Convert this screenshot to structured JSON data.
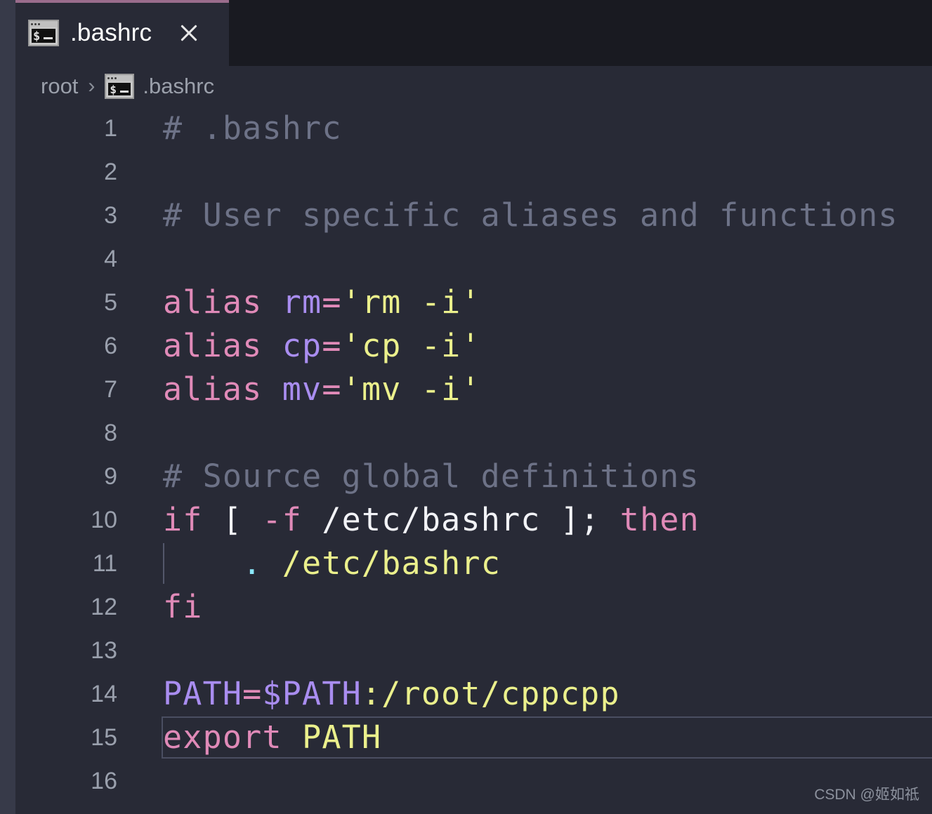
{
  "window": {
    "accent_color": "#9a6c8c",
    "editor_background": "#282a36",
    "tabbar_background": "#191a21",
    "activitybar_color": "#373a49"
  },
  "tab_bar": {
    "tabs": [
      {
        "label": ".bashrc",
        "icon": "terminal-icon",
        "active": true,
        "close_label": "×"
      }
    ]
  },
  "breadcrumb": {
    "root_label": "root",
    "separator": "›",
    "file_icon": "terminal-icon",
    "file_label": ".bashrc"
  },
  "editor": {
    "language": "shellscript",
    "current_line": 15,
    "visible_first_line": 1,
    "visible_last_line": 16,
    "lines": [
      {
        "number": "1",
        "tokens": [
          {
            "text": "# .bashrc",
            "cls": "t-comment"
          }
        ]
      },
      {
        "number": "2",
        "tokens": []
      },
      {
        "number": "3",
        "tokens": [
          {
            "text": "# User specific aliases and functions",
            "cls": "t-comment"
          }
        ]
      },
      {
        "number": "4",
        "tokens": []
      },
      {
        "number": "5",
        "tokens": [
          {
            "text": "alias",
            "cls": "t-keyword"
          },
          {
            "text": " ",
            "cls": "t-plain"
          },
          {
            "text": "rm",
            "cls": "t-var"
          },
          {
            "text": "=",
            "cls": "t-op"
          },
          {
            "text": "'rm -i'",
            "cls": "t-string"
          }
        ]
      },
      {
        "number": "6",
        "tokens": [
          {
            "text": "alias",
            "cls": "t-keyword"
          },
          {
            "text": " ",
            "cls": "t-plain"
          },
          {
            "text": "cp",
            "cls": "t-var"
          },
          {
            "text": "=",
            "cls": "t-op"
          },
          {
            "text": "'cp -i'",
            "cls": "t-string"
          }
        ]
      },
      {
        "number": "7",
        "tokens": [
          {
            "text": "alias",
            "cls": "t-keyword"
          },
          {
            "text": " ",
            "cls": "t-plain"
          },
          {
            "text": "mv",
            "cls": "t-var"
          },
          {
            "text": "=",
            "cls": "t-op"
          },
          {
            "text": "'mv -i'",
            "cls": "t-string"
          }
        ]
      },
      {
        "number": "8",
        "tokens": []
      },
      {
        "number": "9",
        "tokens": [
          {
            "text": "# Source global definitions",
            "cls": "t-comment"
          }
        ]
      },
      {
        "number": "10",
        "tokens": [
          {
            "text": "if",
            "cls": "t-keyword"
          },
          {
            "text": " ",
            "cls": "t-plain"
          },
          {
            "text": "[",
            "cls": "t-plain"
          },
          {
            "text": " ",
            "cls": "t-plain"
          },
          {
            "text": "-f",
            "cls": "t-keyword"
          },
          {
            "text": " ",
            "cls": "t-plain"
          },
          {
            "text": "/etc/bashrc",
            "cls": "t-plain"
          },
          {
            "text": " ];",
            "cls": "t-plain"
          },
          {
            "text": " ",
            "cls": "t-plain"
          },
          {
            "text": "then",
            "cls": "t-keyword"
          }
        ]
      },
      {
        "number": "11",
        "indent_guide": true,
        "tokens": [
          {
            "text": "    ",
            "cls": "t-plain"
          },
          {
            "text": ".",
            "cls": "t-cyan"
          },
          {
            "text": " ",
            "cls": "t-plain"
          },
          {
            "text": "/etc/bashrc",
            "cls": "t-string"
          }
        ]
      },
      {
        "number": "12",
        "tokens": [
          {
            "text": "fi",
            "cls": "t-keyword"
          }
        ]
      },
      {
        "number": "13",
        "tokens": []
      },
      {
        "number": "14",
        "tokens": [
          {
            "text": "PATH",
            "cls": "t-var"
          },
          {
            "text": "=",
            "cls": "t-op"
          },
          {
            "text": "$PATH",
            "cls": "t-var"
          },
          {
            "text": ":/root/cppcpp",
            "cls": "t-string"
          }
        ]
      },
      {
        "number": "15",
        "current": true,
        "tokens": [
          {
            "text": "export",
            "cls": "t-keyword"
          },
          {
            "text": " ",
            "cls": "t-plain"
          },
          {
            "text": "PATH",
            "cls": "t-string"
          }
        ]
      },
      {
        "number": "16",
        "tokens": []
      }
    ]
  },
  "watermark": {
    "text": "CSDN @姬如祗"
  }
}
